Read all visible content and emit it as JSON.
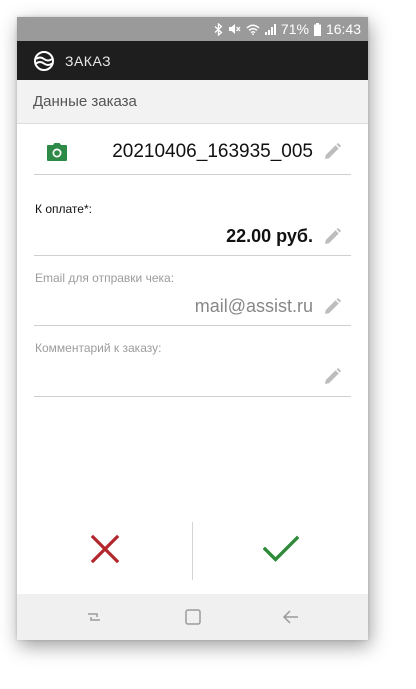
{
  "status_bar": {
    "battery_percent": "71%",
    "time": "16:43",
    "icons": [
      "bluetooth-icon",
      "mute-icon",
      "wifi-icon",
      "signal-icon",
      "battery-icon"
    ]
  },
  "app_bar": {
    "title": "ЗАКАЗ",
    "logo_icon": "assist-logo-icon"
  },
  "section": {
    "title": "Данные заказа"
  },
  "order": {
    "number": "20210406_163935_005",
    "camera_icon": "camera-icon",
    "edit_icon": "pencil-icon"
  },
  "payment": {
    "label": "К оплате*:",
    "amount": "22.00 руб."
  },
  "email": {
    "label": "Email для отправки чека:",
    "value": "mail@assist.ru"
  },
  "comment": {
    "label": "Комментарий к заказу:",
    "value": ""
  },
  "actions": {
    "cancel_icon": "close-icon",
    "confirm_icon": "check-icon"
  },
  "nav_bar": {
    "icons": [
      "recent-apps-icon",
      "home-icon",
      "back-icon"
    ]
  },
  "colors": {
    "status_bar": "#9a9a9a",
    "app_bar": "#1e1e1e",
    "camera": "#2e8b47",
    "cancel": "#b3262c",
    "confirm": "#2e8b3a",
    "pencil": "#bdbdbd"
  }
}
